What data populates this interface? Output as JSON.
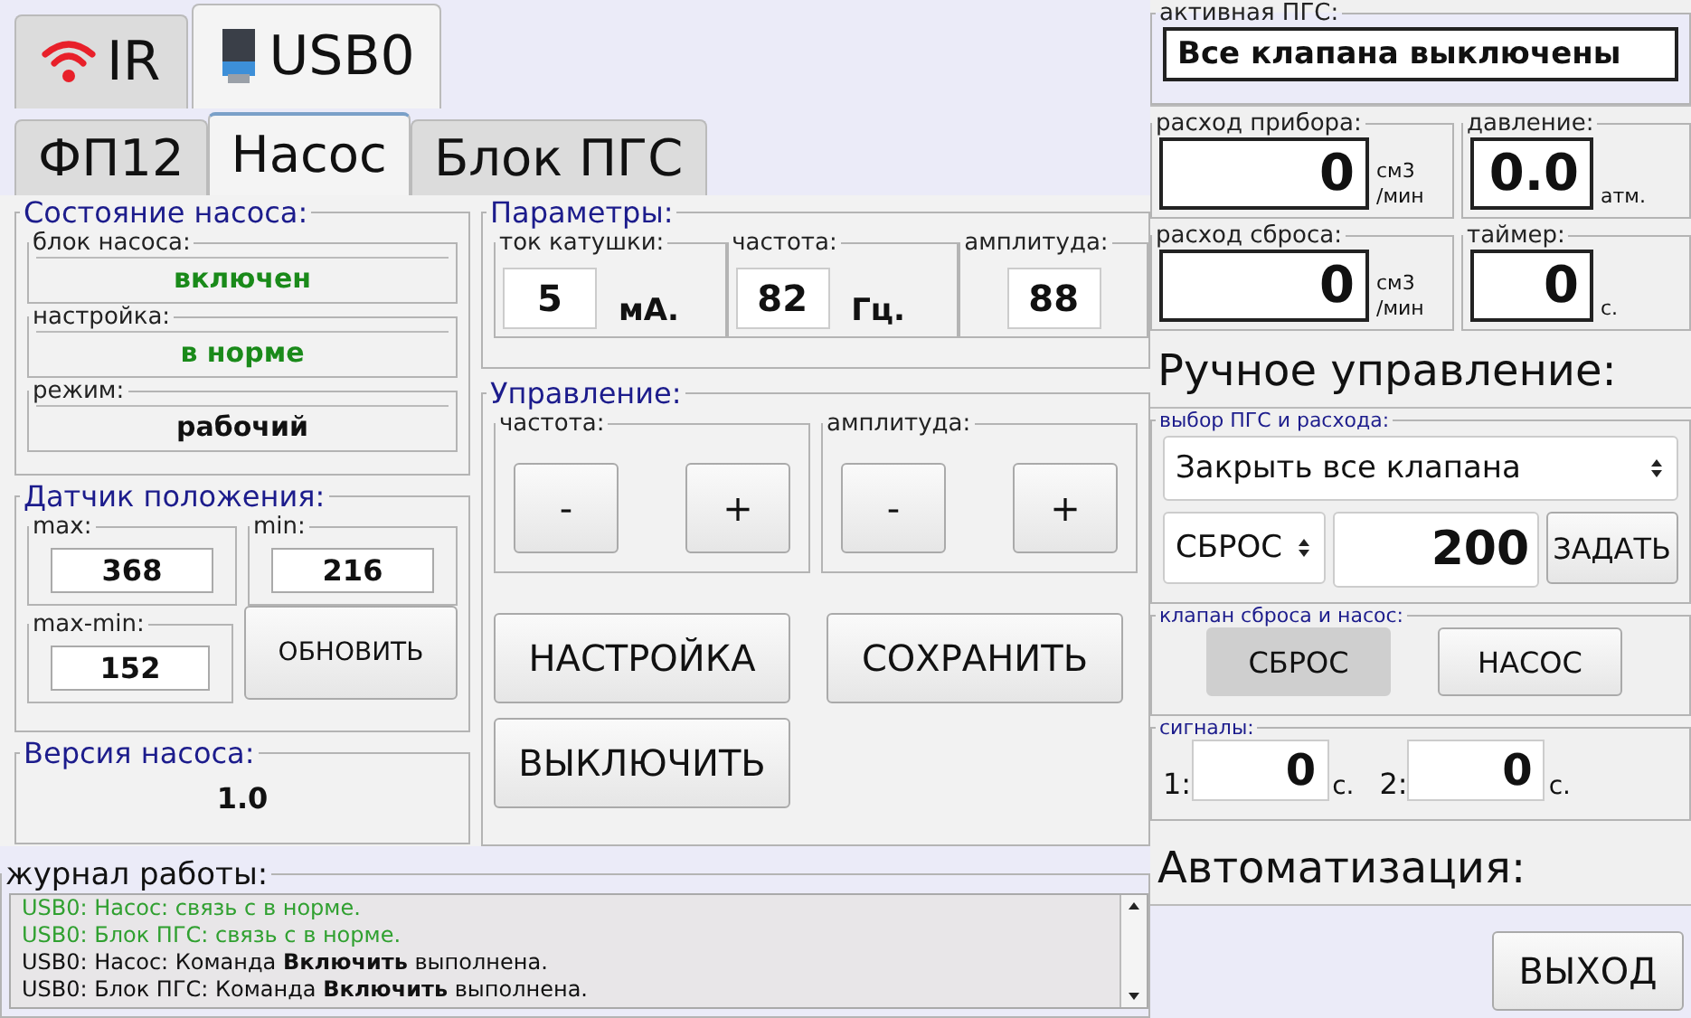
{
  "device_tabs": [
    {
      "kind": "wifi",
      "label": "IR",
      "selected": false
    },
    {
      "kind": "usb",
      "label": "USB0",
      "selected": true
    }
  ],
  "tabs": [
    {
      "label": "ФП12",
      "selected": false
    },
    {
      "label": "Насос",
      "selected": true
    },
    {
      "label": "Блок ПГС",
      "selected": false
    }
  ],
  "pump_state": {
    "title": "Состояние насоса:",
    "fields": [
      {
        "label": "блок насоса:",
        "value": "включен",
        "color": "#1a8a1a"
      },
      {
        "label": "настройка:",
        "value": "в норме",
        "color": "#1a8a1a"
      },
      {
        "label": "режим:",
        "value": "рабочий",
        "color": "#111111"
      }
    ]
  },
  "position_sensor": {
    "title": "Датчик положения:",
    "max": {
      "label": "max:",
      "value": "368"
    },
    "min": {
      "label": "min:",
      "value": "216"
    },
    "diff": {
      "label": "max-min:",
      "value": "152"
    },
    "button": "ОБНОВИТЬ"
  },
  "version": {
    "title": "Версия насоса:",
    "value": "1.0"
  },
  "parameters": {
    "title": "Параметры:",
    "fields": [
      {
        "label": "ток катушки:",
        "value": "5",
        "unit": "мА."
      },
      {
        "label": "частота:",
        "value": "82",
        "unit": "Гц."
      },
      {
        "label": "амплитуда:",
        "value": "88"
      }
    ]
  },
  "control": {
    "title": "Управление:",
    "groups": [
      {
        "label": "частота:",
        "minus": "-",
        "plus": "+"
      },
      {
        "label": "амплитуда:",
        "minus": "-",
        "plus": "+"
      }
    ],
    "buttons": [
      "НАСТРОЙКА",
      "СОХРАНИТЬ",
      "ВЫКЛЮЧИТЬ"
    ]
  },
  "log": {
    "title": "журнал работы:",
    "lines": [
      {
        "kind": "ok",
        "text": "USB0: Насос: связь с в норме."
      },
      {
        "kind": "ok",
        "text": "USB0: Блок ПГС: связь с в норме."
      },
      {
        "kind": "plain",
        "text": "USB0: Насос: Команда **Включить** выполнена."
      },
      {
        "kind": "plain",
        "text": "USB0: Блок ПГС: Команда **Включить** выполнена."
      }
    ]
  },
  "active_pgs": {
    "label": "активная ПГС:",
    "value": "Все клапана выключены"
  },
  "readings": [
    {
      "label": "расход прибора:",
      "value": "0",
      "unit": "см3 /мин"
    },
    {
      "label": "давление:",
      "value": "0.0",
      "unit": "атм."
    },
    {
      "label": "расход сброса:",
      "value": "0",
      "unit": "см3 /мин"
    },
    {
      "label": "таймер:",
      "value": "0",
      "unit": "с."
    }
  ],
  "manual": {
    "title": "Ручное управление:",
    "selection": {
      "label": "выбор ПГС и расхода:",
      "gas": "Закрыть все клапана",
      "target": "СБРОС",
      "flow": "200",
      "set_button": "ЗАДАТЬ"
    },
    "valves": {
      "label": "клапан сброса и насос:",
      "buttons": [
        {
          "label": "СБРОС",
          "selected": true
        },
        {
          "label": "НАСОС",
          "selected": false
        }
      ]
    },
    "signals": {
      "label": "сигналы:",
      "items": [
        {
          "index": "1:",
          "value": "0",
          "unit": "с."
        },
        {
          "index": "2:",
          "value": "0",
          "unit": "с."
        }
      ]
    }
  },
  "automation": {
    "title": "Автоматизация:"
  },
  "exit_button": "ВЫХОД"
}
